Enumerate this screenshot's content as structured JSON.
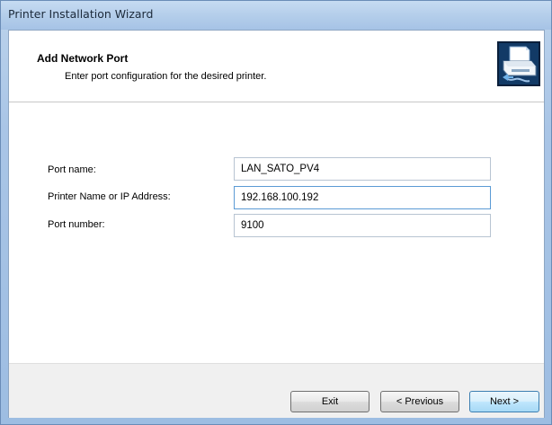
{
  "window": {
    "title": "Printer Installation Wizard"
  },
  "header": {
    "title": "Add Network Port",
    "subtitle": "Enter port configuration for the desired printer.",
    "icon": "printer-network-icon"
  },
  "form": {
    "port_name_label": "Port name:",
    "port_name_value": "LAN_SATO_PV4",
    "ip_label": "Printer Name or IP Address:",
    "ip_value": "192.168.100.192",
    "port_number_label": "Port number:",
    "port_number_value": "9100"
  },
  "footer": {
    "exit_label": "Exit",
    "previous_label": "< Previous",
    "next_label": "Next >"
  },
  "colors": {
    "title_bar": "#b3cdea",
    "focus_border": "#5b9bd5",
    "default_button": "#bee6fd"
  }
}
